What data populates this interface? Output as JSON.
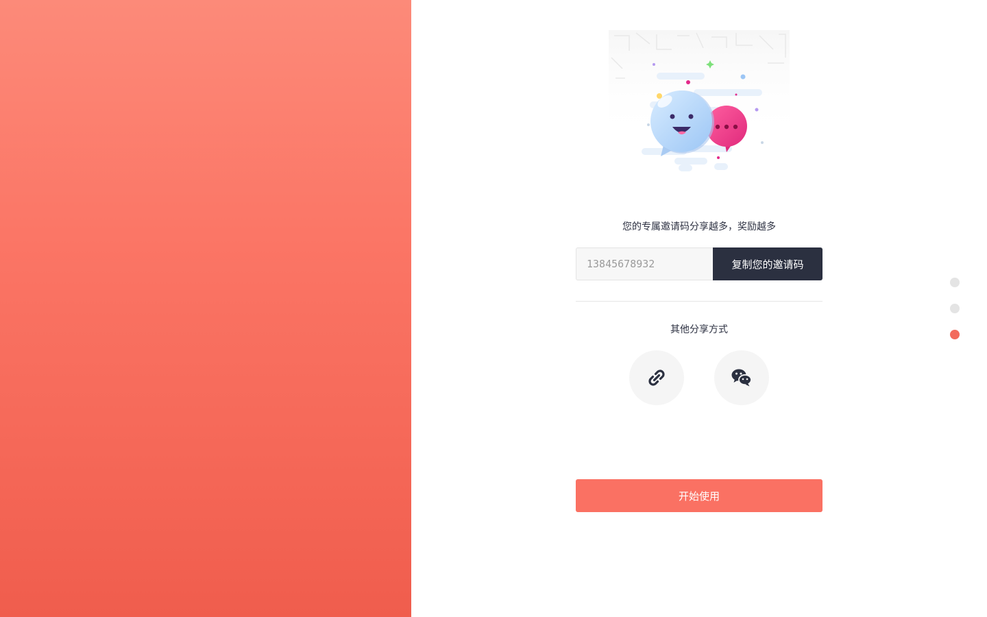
{
  "invite": {
    "headline": "您的专属邀请码分享越多，奖励越多",
    "code_value": "",
    "code_placeholder": "13845678932",
    "copy_label": "复制您的邀请码"
  },
  "share": {
    "title": "其他分享方式",
    "options": [
      {
        "icon": "link-icon"
      },
      {
        "icon": "wechat-icon"
      }
    ]
  },
  "start_label": "开始使用",
  "pager": {
    "total": 3,
    "active_index": 2
  },
  "colors": {
    "accent": "#fa7163",
    "dark_button": "#2b3040",
    "left_gradient_top": "#fc8a79",
    "left_gradient_bottom": "#f05d4d"
  }
}
